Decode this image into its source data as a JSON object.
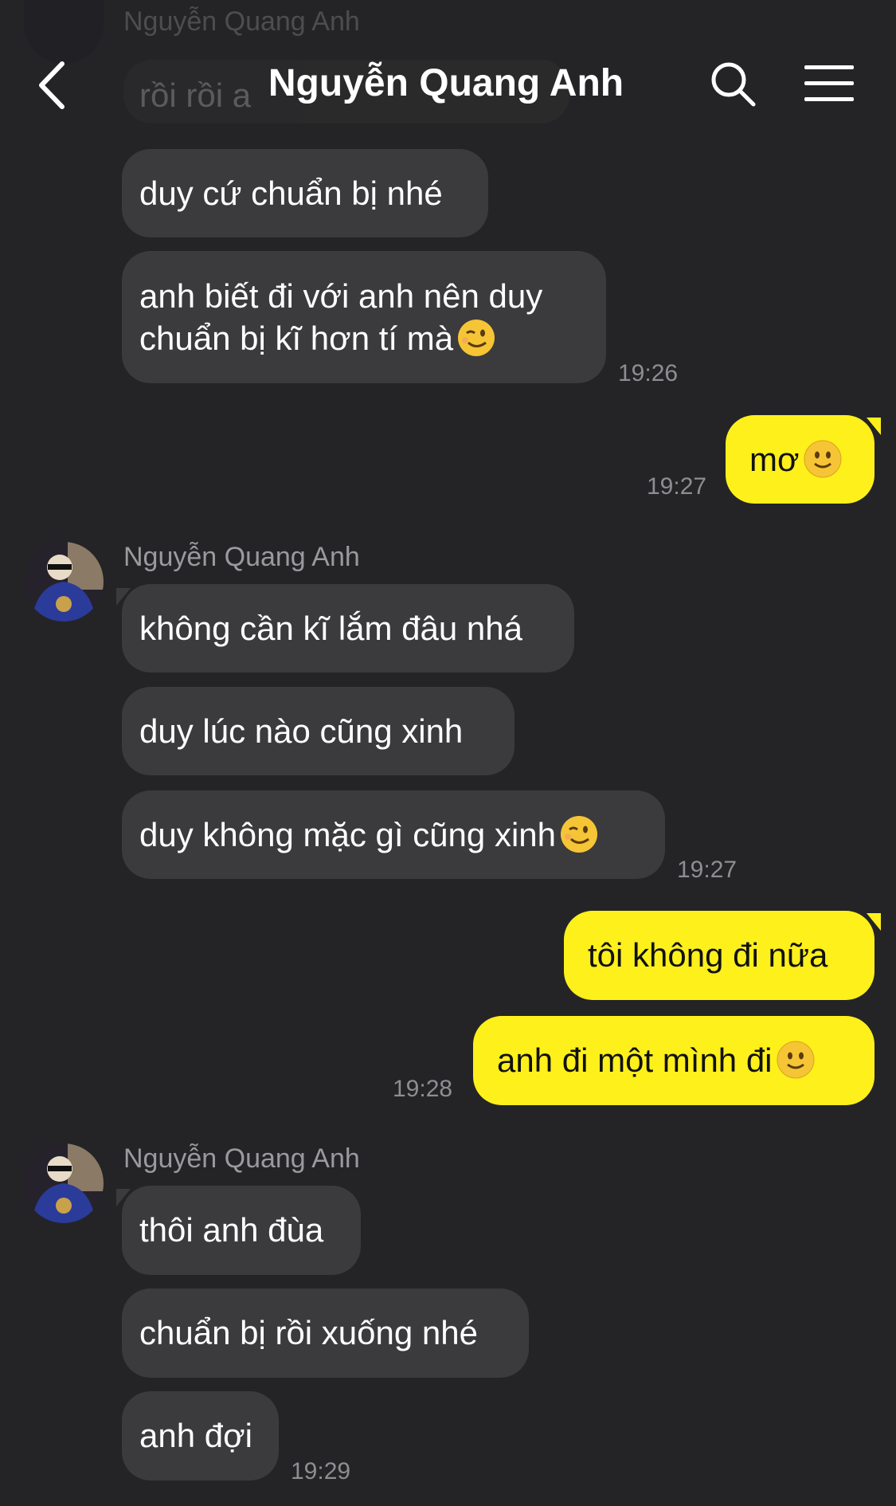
{
  "header": {
    "title": "Nguyễn Quang Anh",
    "icons": {
      "back": "chevron-left-icon",
      "search": "search-icon",
      "menu": "hamburger-menu-icon"
    }
  },
  "partial_top": {
    "name": "Nguyễn Quang Anh",
    "text": "rồi rồi a"
  },
  "group1": {
    "messages": [
      "duy cứ chuẩn bị nhé",
      "anh biết đi với anh nên duy",
      "chuẩn bị kĩ hơn tí mà"
    ],
    "time": "19:26"
  },
  "out1": {
    "text": "mơ",
    "time": "19:27"
  },
  "group2": {
    "name": "Nguyễn Quang Anh",
    "messages": [
      "không cần kĩ lắm đâu nhá",
      "duy lúc nào cũng xinh",
      "duy không mặc gì cũng xinh"
    ],
    "time": "19:27"
  },
  "out2": {
    "messages": [
      "tôi không đi nữa",
      "anh đi một mình đi"
    ],
    "time": "19:28"
  },
  "group3": {
    "name": "Nguyễn Quang Anh",
    "messages": [
      "thôi anh đùa",
      "chuẩn bị rồi xuống nhé",
      "anh đợi"
    ],
    "time": "19:29"
  },
  "colors": {
    "background": "#242426",
    "incoming": "#3b3b3d",
    "outgoing": "#fef01b"
  }
}
